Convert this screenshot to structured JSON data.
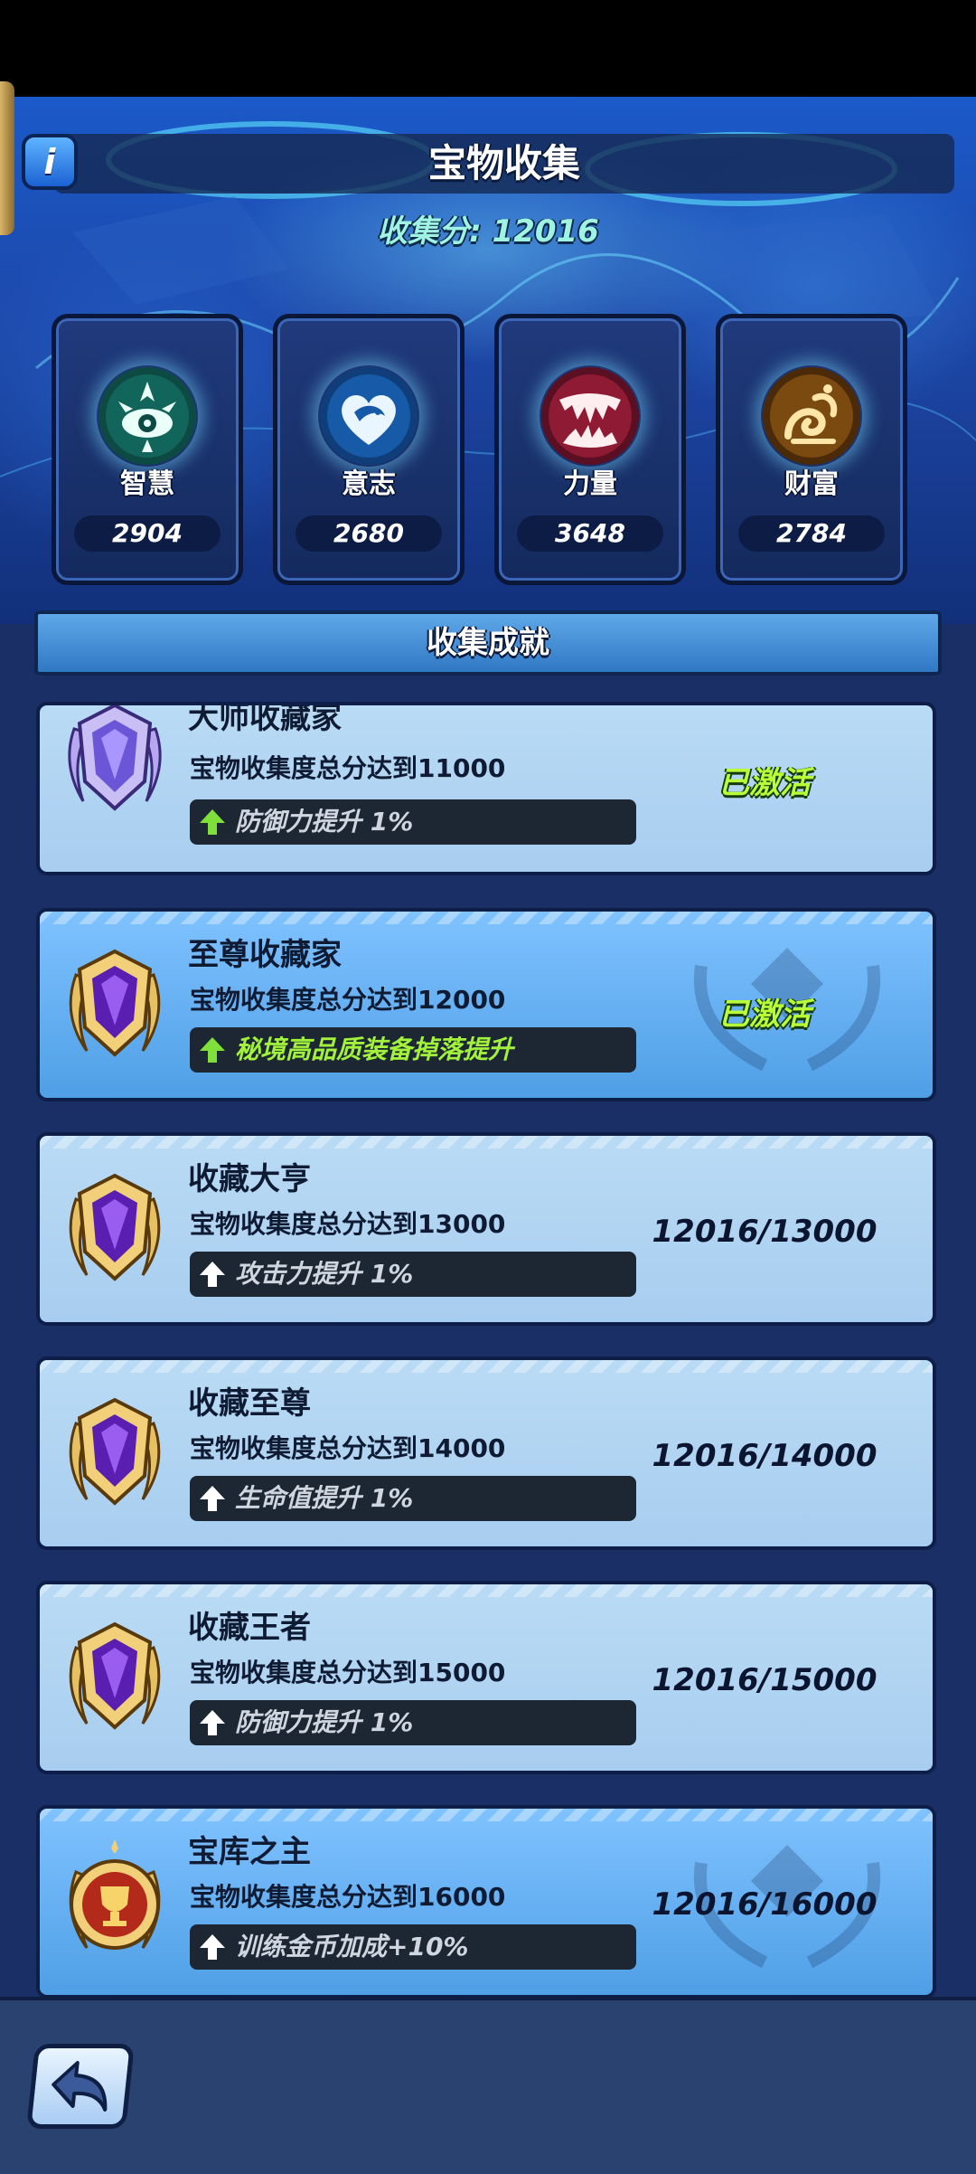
{
  "header": {
    "title": "宝物收集",
    "info_icon": "info-icon",
    "score_label": "收集分: 12016"
  },
  "stats": [
    {
      "name": "智慧",
      "value": "2904",
      "icon": "eye-emblem-icon",
      "color": "#27c3a0"
    },
    {
      "name": "意志",
      "value": "2680",
      "icon": "heart-serpent-icon",
      "color": "#2f9cf0"
    },
    {
      "name": "力量",
      "value": "3648",
      "icon": "fangs-icon",
      "color": "#d9304a"
    },
    {
      "name": "财富",
      "value": "2784",
      "icon": "gold-swirl-icon",
      "color": "#e39a23"
    }
  ],
  "section": {
    "title": "收集成就"
  },
  "achievements": [
    {
      "name": "大师收藏家",
      "requirement": "宝物收集度总分达到11000",
      "bonus": "防御力提升 1%",
      "status": "已激活",
      "state": "active",
      "badge": "silver-shield-badge-icon"
    },
    {
      "name": "至尊收藏家",
      "requirement": "宝物收集度总分达到12000",
      "bonus": "秘境高品质装备掉落提升",
      "status": "已激活",
      "state": "active",
      "badge": "gold-shield-badge-icon"
    },
    {
      "name": "收藏大亨",
      "requirement": "宝物收集度总分达到13000",
      "bonus": "攻击力提升 1%",
      "status": "12016/13000",
      "state": "progress",
      "badge": "gold-shield-badge-icon"
    },
    {
      "name": "收藏至尊",
      "requirement": "宝物收集度总分达到14000",
      "bonus": "生命值提升 1%",
      "status": "12016/14000",
      "state": "progress",
      "badge": "gold-shield-badge-icon"
    },
    {
      "name": "收藏王者",
      "requirement": "宝物收集度总分达到15000",
      "bonus": "防御力提升 1%",
      "status": "12016/15000",
      "state": "progress",
      "badge": "gold-shield-badge-icon"
    },
    {
      "name": "宝库之主",
      "requirement": "宝物收集度总分达到16000",
      "bonus": "训练金币加成+10%",
      "status": "12016/16000",
      "state": "progress",
      "badge": "gold-trophy-badge-icon"
    }
  ],
  "footer": {
    "back_icon": "back-arrow-icon"
  }
}
